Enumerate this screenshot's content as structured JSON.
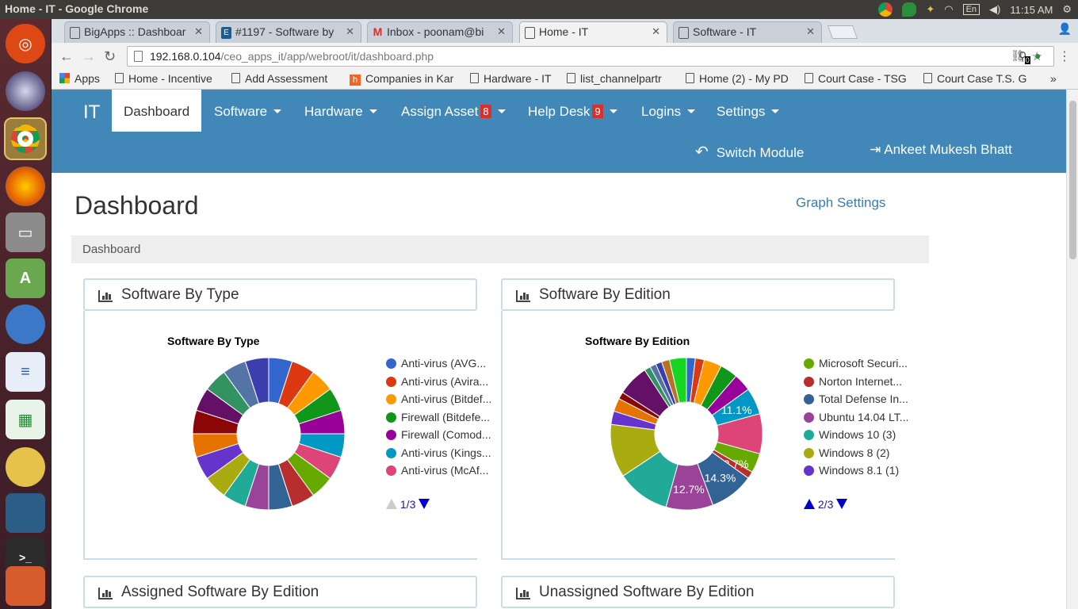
{
  "window": {
    "title": "Home - IT - Google Chrome",
    "time": "11:15 AM",
    "keyboard": "En"
  },
  "tabs": [
    {
      "label": "BigApps :: Dashboar",
      "icon": "page-icon"
    },
    {
      "label": "#1197 - Software by",
      "icon": "e-icon"
    },
    {
      "label": "Inbox - poonam@bi",
      "icon": "gmail-icon"
    },
    {
      "label": "Home - IT",
      "icon": "page-icon",
      "active": true
    },
    {
      "label": "Software - IT",
      "icon": "page-icon"
    }
  ],
  "address": {
    "host": "192.168.0.104",
    "path": "/ceo_apps_it/app/webroot/it/dashboard.php",
    "ext_badge": "0"
  },
  "bookmarks": [
    "Apps",
    "Home - Incentive",
    "Add Assessment",
    "Companies in Kar",
    "Hardware - IT",
    "list_channelpartr",
    "Home (2) - My PD",
    "Court Case - TSG",
    "Court Case T.S. G"
  ],
  "nav": {
    "brand": "IT",
    "items": [
      {
        "label": "Dashboard",
        "active": true
      },
      {
        "label": "Software",
        "caret": true
      },
      {
        "label": "Hardware",
        "caret": true
      },
      {
        "label": "Assign Asset",
        "badge": "8",
        "caret": true
      },
      {
        "label": "Help Desk",
        "badge": "9",
        "caret": true
      },
      {
        "label": "Logins",
        "caret": true
      },
      {
        "label": "Settings",
        "caret": true
      }
    ],
    "switch_module": "Switch Module",
    "user": "Ankeet Mukesh Bhatt"
  },
  "page": {
    "title": "Dashboard",
    "graph_settings": "Graph Settings",
    "breadcrumb": "Dashboard"
  },
  "panels": [
    {
      "heading": "Software By Type"
    },
    {
      "heading": "Software By Edition"
    },
    {
      "heading": "Assigned Software By Edition"
    },
    {
      "heading": "Unassigned Software By Edition"
    }
  ],
  "chart_data": [
    {
      "type": "pie",
      "title": "Software By Type",
      "donut": true,
      "values": [
        5,
        5,
        5,
        5,
        5,
        5,
        5,
        5,
        5,
        5,
        5,
        5,
        5,
        5,
        5,
        5,
        5,
        5,
        5,
        5
      ],
      "colors": [
        "#3366cc",
        "#dc3912",
        "#ff9900",
        "#109618",
        "#990099",
        "#0099c6",
        "#dd4477",
        "#66aa00",
        "#b82e2e",
        "#316395",
        "#994499",
        "#22aa99",
        "#aaaa11",
        "#6633cc",
        "#e67300",
        "#8b0707",
        "#651067",
        "#329262",
        "#5574a6",
        "#3b3eac"
      ],
      "legend": [
        {
          "label": "Anti-virus (AVG...",
          "color": "#3366cc"
        },
        {
          "label": "Anti-virus (Avira...",
          "color": "#dc3912"
        },
        {
          "label": "Anti-virus (Bitdef...",
          "color": "#ff9900"
        },
        {
          "label": "Firewall (Bitdefe...",
          "color": "#109618"
        },
        {
          "label": "Firewall (Comod...",
          "color": "#990099"
        },
        {
          "label": "Anti-virus (Kings...",
          "color": "#0099c6"
        },
        {
          "label": "Anti-virus (McAf...",
          "color": "#dd4477"
        }
      ],
      "pager": "1/3",
      "up_enabled": false
    },
    {
      "type": "pie",
      "title": "Software By Edition",
      "donut": true,
      "values": [
        1,
        1,
        2,
        2,
        2,
        3,
        4.5,
        2.2,
        0.8,
        5,
        5.3,
        6,
        6,
        1.5,
        1.5,
        0.8,
        3.5,
        0.7,
        0.7,
        0.7,
        0.9,
        1.9
      ],
      "colors": [
        "#3366cc",
        "#dc3912",
        "#ff9900",
        "#109618",
        "#990099",
        "#0099c6",
        "#dd4477",
        "#66aa00",
        "#b82e2e",
        "#316395",
        "#994499",
        "#22aa99",
        "#aaaa11",
        "#6633cc",
        "#e67300",
        "#8b0707",
        "#651067",
        "#329262",
        "#5574a6",
        "#3b3eac",
        "#b77322",
        "#16d620"
      ],
      "slice_labels": {
        "5": "11.1%",
        "8": "12.7%",
        "9": "14.3%",
        "10": "12.7%"
      },
      "legend": [
        {
          "label": "Microsoft Securi...",
          "color": "#66aa00"
        },
        {
          "label": "Norton Internet...",
          "color": "#b82e2e"
        },
        {
          "label": "Total Defense In...",
          "color": "#316395"
        },
        {
          "label": "Ubuntu 14.04 LT...",
          "color": "#994499"
        },
        {
          "label": "Windows 10 (3)",
          "color": "#22aa99"
        },
        {
          "label": "Windows 8 (2)",
          "color": "#aaaa11"
        },
        {
          "label": "Windows 8.1 (1)",
          "color": "#6633cc"
        }
      ],
      "pager": "2/3",
      "up_enabled": true
    }
  ],
  "colors": {
    "header": "#4187b7",
    "badge": "#d9302c",
    "link": "#3a7bb0"
  }
}
